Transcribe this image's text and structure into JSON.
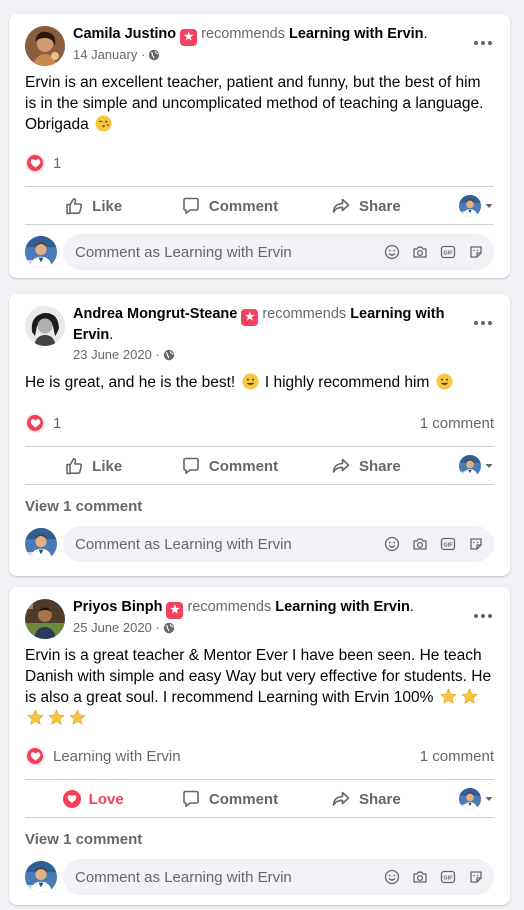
{
  "common": {
    "recommends": "recommends",
    "like_label": "Like",
    "love_label": "Love",
    "comment_label": "Comment",
    "share_label": "Share",
    "view_comments": "View 1 comment",
    "comment_placeholder": "Comment as Learning with Ervin",
    "page_name": "Learning with Ervin",
    "gif_label": "GIF"
  },
  "posts": [
    {
      "author": "Camila Justino",
      "page": "Learning with Ervin",
      "date": "14 January",
      "text": "Ervin is an excellent teacher, patient and funny, but the best of him is in the simple and uncomplicated method of teaching a language. Obrigada",
      "reaction_count": "1"
    },
    {
      "author": "Andrea Mongrut-Steane",
      "page": "Learning with Ervin",
      "date": "23 June 2020",
      "text_a": "He is great, and he is the best!",
      "text_b": "I highly recommend him",
      "reaction_count": "1",
      "comment_count": "1 comment"
    },
    {
      "author": "Priyos Binph",
      "page": "Learning with Ervin",
      "date": "25 June 2020",
      "text": "Ervin is a great teacher & Mentor Ever I have been seen. He teach Danish with simple and easy Way but very effective for students. He is also a great soul. I recommend Learning with Ervin 100%",
      "reactor": "Learning with Ervin",
      "comment_count": "1 comment"
    }
  ],
  "colors": {
    "accent_red": "#f33e58",
    "text_secondary": "#65676b",
    "background": "#f0f2f5"
  }
}
